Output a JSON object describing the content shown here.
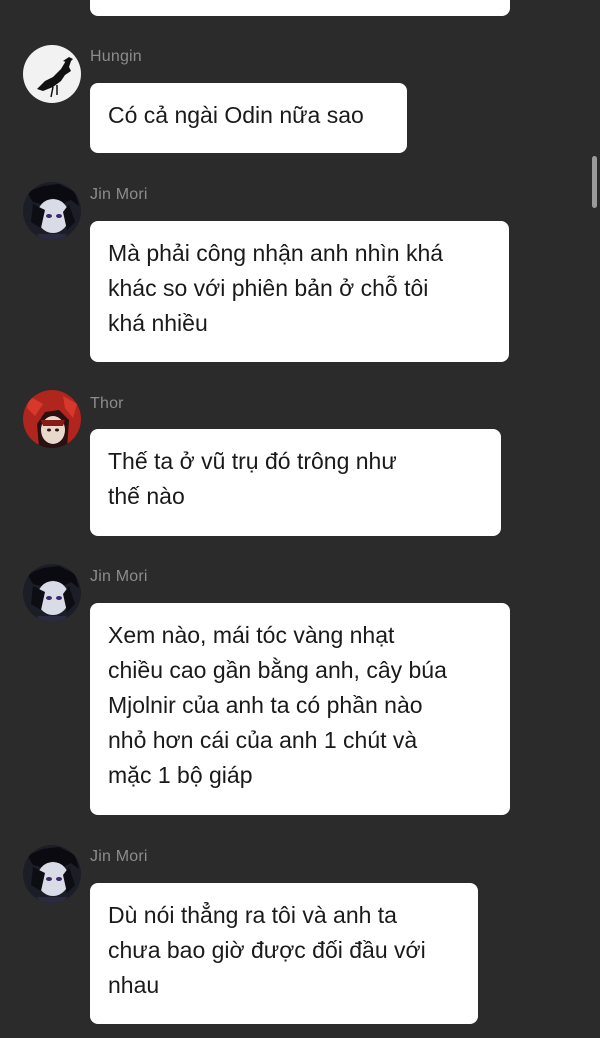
{
  "messages": [
    {
      "sender": "Hungin",
      "avatar_icon": "crow-icon",
      "lines": [
        "Có cả ngài Odin nữa sao"
      ]
    },
    {
      "sender": "Jin Mori",
      "avatar_icon": "anime-character-avatar",
      "lines": [
        "Mà phải công nhận anh nhìn khá",
        "khác so với phiên bản ở chỗ tôi",
        "khá nhiều"
      ]
    },
    {
      "sender": "Thor",
      "avatar_icon": "red-haired-character-avatar",
      "lines": [
        "Thế ta ở vũ trụ đó trông như",
        "thế nào"
      ]
    },
    {
      "sender": "Jin Mori",
      "avatar_icon": "anime-character-avatar",
      "lines": [
        "Xem nào, mái tóc vàng nhạt",
        "chiều cao gần bằng anh, cây búa",
        "Mjolnir của anh ta có phần nào",
        "nhỏ hơn cái của anh 1 chút và",
        "mặc 1 bộ giáp"
      ]
    },
    {
      "sender": "Jin Mori",
      "avatar_icon": "anime-character-avatar",
      "lines": [
        "Dù nói thẳng ra tôi và anh ta",
        "chưa bao giờ được đối đầu với",
        "nhau"
      ]
    }
  ],
  "colors": {
    "background": "#2b2b2b",
    "bubble": "#ffffff",
    "name_text": "#8c8c8c",
    "message_text": "#1a1a1a"
  }
}
